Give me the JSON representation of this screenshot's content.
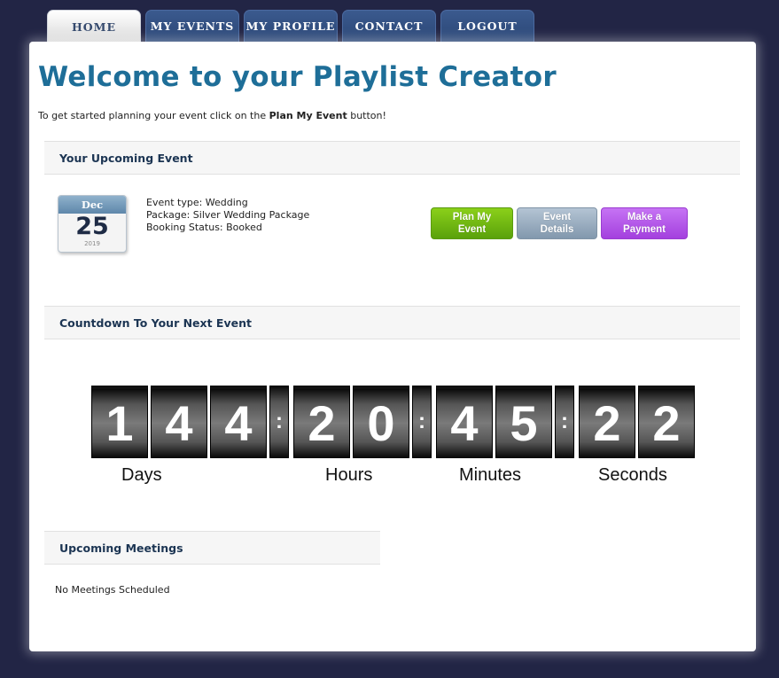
{
  "nav": {
    "tabs": [
      {
        "label": "HOME",
        "active": true
      },
      {
        "label": "MY EVENTS",
        "active": false
      },
      {
        "label": "MY PROFILE",
        "active": false
      },
      {
        "label": "CONTACT",
        "active": false
      },
      {
        "label": "LOGOUT",
        "active": false
      }
    ]
  },
  "page": {
    "title": "Welcome to your Playlist Creator",
    "intro_prefix": "To get started planning your event click on the ",
    "intro_bold": "Plan My Event",
    "intro_suffix": " button!"
  },
  "upcoming_event": {
    "heading": "Your Upcoming Event",
    "calendar": {
      "month": "Dec",
      "day": "25",
      "year": "2019"
    },
    "event_type": "Event type: Wedding",
    "package": "Package: Silver Wedding Package",
    "booking_status": "Booking Status: Booked",
    "buttons": {
      "plan": "Plan My Event",
      "details": "Event Details",
      "payment": "Make a Payment"
    }
  },
  "countdown": {
    "heading": "Countdown To Your Next Event",
    "digits": {
      "days": [
        "1",
        "4",
        "4"
      ],
      "hours": [
        "2",
        "0"
      ],
      "minutes": [
        "4",
        "5"
      ],
      "seconds": [
        "2",
        "2"
      ]
    },
    "separator": ":",
    "labels": {
      "days": "Days",
      "hours": "Hours",
      "minutes": "Minutes",
      "seconds": "Seconds"
    }
  },
  "meetings": {
    "heading": "Upcoming Meetings",
    "empty_text": "No Meetings Scheduled"
  },
  "colors": {
    "background": "#222545",
    "title": "#1e6e98",
    "plan_button": "#6bb611",
    "details_button": "#9aafc2",
    "payment_button": "#b455e8"
  }
}
